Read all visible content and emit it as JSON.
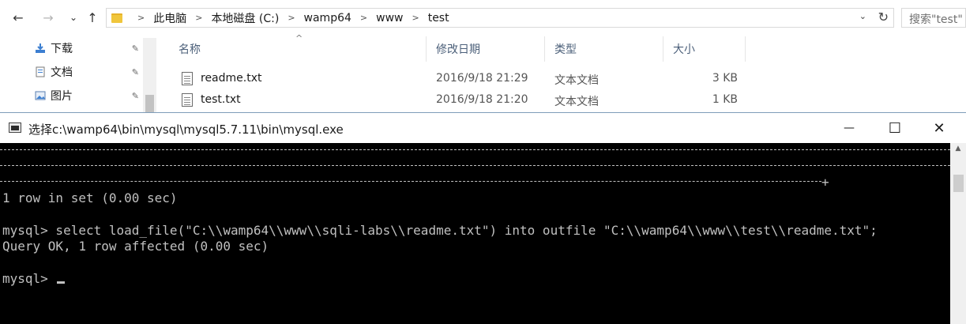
{
  "explorer": {
    "nav": {
      "back": "←",
      "forward": "→",
      "recent": "⌄",
      "up": "↑"
    },
    "breadcrumb": [
      "此电脑",
      "本地磁盘 (C:)",
      "wamp64",
      "www",
      "test"
    ],
    "address_dropdown": "⌄",
    "refresh": "↻",
    "search_placeholder": "搜索\"test\"",
    "quick_access": [
      {
        "label": "下载",
        "pin": "📌"
      },
      {
        "label": "文档",
        "pin": "📌"
      },
      {
        "label": "图片",
        "pin": "📌"
      }
    ],
    "columns": {
      "name": "名称",
      "modified": "修改日期",
      "type": "类型",
      "size": "大小",
      "sort_indicator": "^"
    },
    "files": [
      {
        "name": "readme.txt",
        "modified": "2016/9/18 21:29",
        "type": "文本文档",
        "size": "3 KB"
      },
      {
        "name": "test.txt",
        "modified": "2016/9/18 21:20",
        "type": "文本文档",
        "size": "1 KB"
      }
    ]
  },
  "console": {
    "title": "选择c:\\wamp64\\bin\\mysql\\mysql5.7.11\\bin\\mysql.exe",
    "controls": {
      "minimize": "—",
      "maximize": "☐",
      "close": "✕"
    },
    "terminal": {
      "table_end": "+",
      "rowcount": "1 row in set (0.00 sec)",
      "command": "mysql> select load_file(\"C:\\\\wamp64\\\\www\\\\sqli-labs\\\\readme.txt\") into outfile \"C:\\\\wamp64\\\\www\\\\test\\\\readme.txt\";",
      "result": "Query OK, 1 row affected (0.00 sec)",
      "prompt": "mysql> "
    },
    "scroll_up": "▲"
  },
  "colors": {
    "terminal_bg": "#000000",
    "terminal_fg": "#c0c0c0",
    "folder_yellow": "#f0c63c",
    "header_text": "#4c607a"
  }
}
